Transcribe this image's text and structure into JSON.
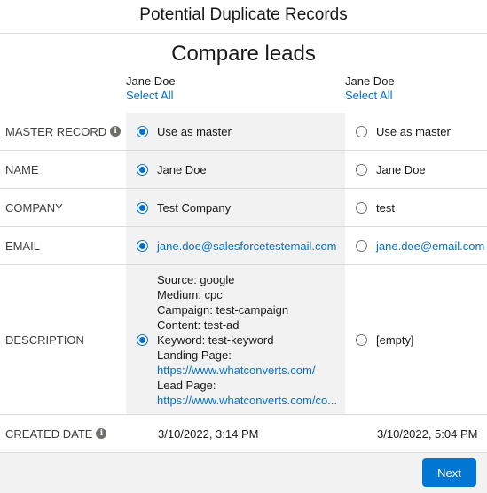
{
  "header": {
    "title": "Potential Duplicate Records"
  },
  "subtitle": "Compare leads",
  "records": [
    {
      "name": "Jane Doe",
      "select_all": "Select All"
    },
    {
      "name": "Jane Doe",
      "select_all": "Select All"
    }
  ],
  "rows": {
    "master": {
      "label": "MASTER RECORD",
      "info_icon": "info-icon",
      "values": [
        "Use as master",
        "Use as master"
      ],
      "selected": 0
    },
    "name": {
      "label": "NAME",
      "values": [
        "Jane Doe",
        "Jane Doe"
      ],
      "selected": 0
    },
    "company": {
      "label": "COMPANY",
      "values": [
        "Test Company",
        "test"
      ],
      "selected": 0
    },
    "email": {
      "label": "EMAIL",
      "values": [
        "jane.doe@salesforcetestemail.com",
        "jane.doe@email.com"
      ],
      "selected": 0
    },
    "description": {
      "label": "DESCRIPTION",
      "record1_lines": [
        "Source: google",
        "Medium: cpc",
        "Campaign: test-campaign",
        "Content: test-ad",
        "Keyword: test-keyword",
        "Landing Page:",
        "https://www.whatconverts.com/",
        "Lead Page:",
        "https://www.whatconverts.com/co..."
      ],
      "record2": "[empty]",
      "selected": 0
    },
    "created": {
      "label": "CREATED DATE",
      "info_icon": "info-icon",
      "values": [
        "3/10/2022, 3:14 PM",
        "3/10/2022, 5:04 PM"
      ]
    }
  },
  "footer": {
    "next_label": "Next"
  },
  "colors": {
    "accent": "#0070d2",
    "button": "#0176d3",
    "selected_column_bg": "#f3f2f2"
  }
}
